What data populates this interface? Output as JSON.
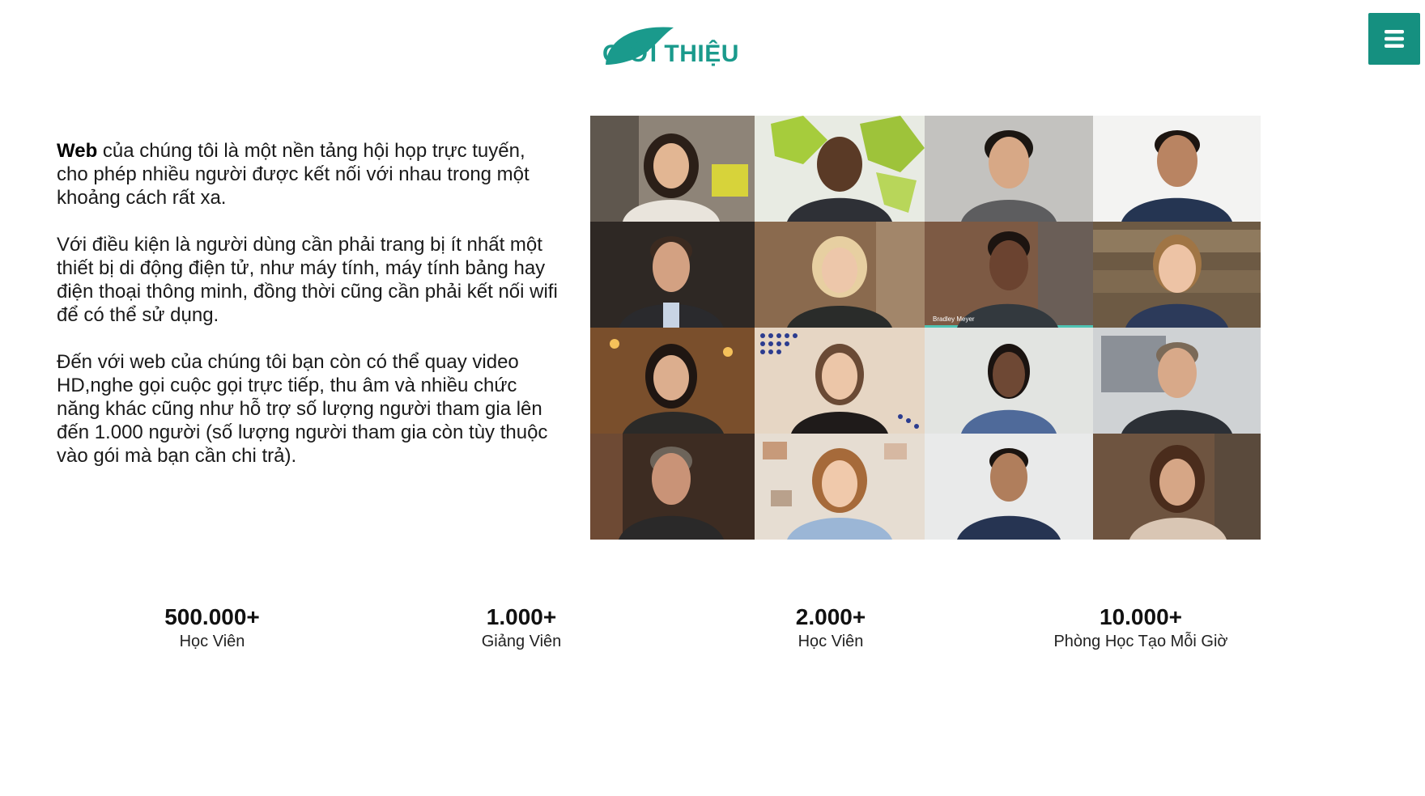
{
  "header": {
    "title": "GIỚI THIỆU",
    "accent_color": "#1a9a8c",
    "leaf_color": "#1a9a8c"
  },
  "menu_button": {
    "icon": "hamburger-menu-icon",
    "color": "#159080"
  },
  "intro": {
    "p1_strong": "Web",
    "p1_rest": " của chúng tôi là một nền tảng hội họp trực tuyến, cho phép nhiều người được kết nối với nhau trong một khoảng cách rất xa.",
    "p2": "Với điều kiện là người dùng cần phải trang bị ít nhất một thiết bị di động điện tử, như máy tính, máy tính bảng hay điện thoại thông minh, đồng thời cũng cần phải kết nối wifi để có thể sử dụng.",
    "p3": "Đến với web của chúng tôi bạn còn có thể quay video HD,nghe gọi cuộc gọi trực tiếp, thu âm và nhiều chức năng khác cũng như hỗ trợ số lượng người tham gia lên đến 1.000 người (số lượng người tham gia còn tùy thuộc vào gói mà bạn cần chi trả)."
  },
  "video_grid": {
    "participant_label": "Bradley Meyer"
  },
  "stats": [
    {
      "value": "500.000+",
      "label": "Học Viên"
    },
    {
      "value": "1.000+",
      "label": "Giảng Viên"
    },
    {
      "value": "2.000+",
      "label": "Học Viên"
    },
    {
      "value": "10.000+",
      "label": "Phòng Học Tạo Mỗi Giờ"
    }
  ]
}
